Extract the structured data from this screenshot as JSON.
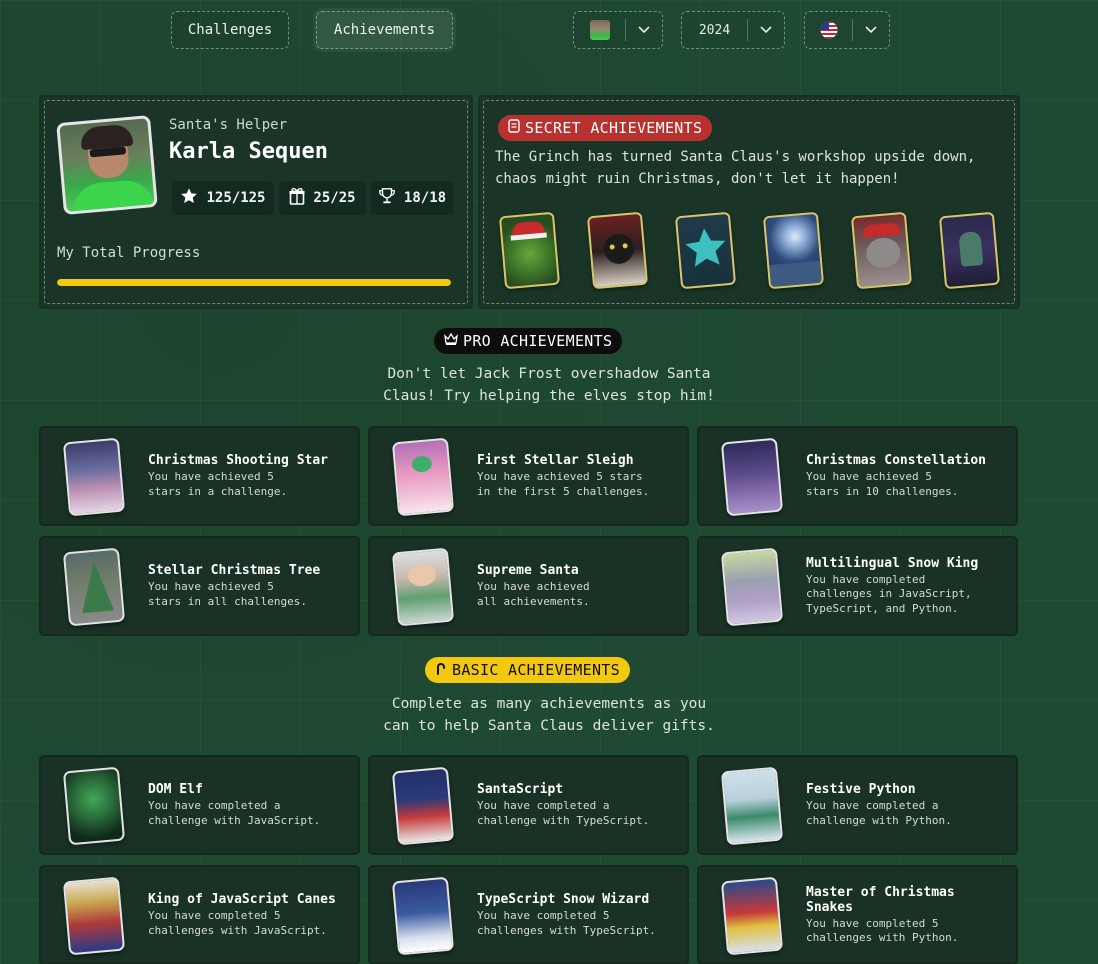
{
  "nav": {
    "challenges_label": "Challenges",
    "achievements_label": "Achievements",
    "year": "2024"
  },
  "profile": {
    "title": "Santa's Helper",
    "name": "Karla Sequen",
    "stats": [
      {
        "icon": "star-icon",
        "value": "125/125"
      },
      {
        "icon": "gift-icon",
        "value": "25/25"
      },
      {
        "icon": "trophy-icon",
        "value": "18/18"
      }
    ],
    "progress_label": "My Total Progress",
    "progress": 1.0
  },
  "secret": {
    "badge": "SECRET ACHIEVEMENTS",
    "description": "The Grinch has turned Santa Claus's workshop upside down, chaos might ruin Christmas, don't let it happen!",
    "cards": [
      "grinch-card",
      "black-cat-card",
      "teal-star-card",
      "moon-night-card",
      "gray-cat-card",
      "dark-wizard-card"
    ]
  },
  "pro": {
    "badge": "PRO ACHIEVEMENTS",
    "description_line1": "Don't let Jack Frost overshadow Santa",
    "description_line2": "Claus! Try helping the elves stop him!",
    "items": [
      {
        "title": "Christmas Shooting Star",
        "desc": "You have achieved 5\nstars in a challenge."
      },
      {
        "title": "First Stellar Sleigh",
        "desc": "You have achieved 5 stars\nin the first 5 challenges."
      },
      {
        "title": "Christmas Constellation",
        "desc": "You have achieved 5\nstars in 10 challenges."
      },
      {
        "title": "Stellar Christmas Tree",
        "desc": "You have achieved 5\nstars in all challenges."
      },
      {
        "title": "Supreme Santa",
        "desc": "You have achieved\nall achievements."
      },
      {
        "title": "Multilingual Snow King",
        "desc": "You have completed\nchallenges in JavaScript,\nTypeScript, and Python."
      }
    ]
  },
  "basic": {
    "badge": "BASIC ACHIEVEMENTS",
    "description_line1": "Complete as many achievements as you",
    "description_line2": "can to help Santa Claus deliver gifts.",
    "items": [
      {
        "title": "DOM Elf",
        "desc": "You have completed a\nchallenge with JavaScript."
      },
      {
        "title": "SantaScript",
        "desc": "You have completed a\nchallenge with TypeScript."
      },
      {
        "title": "Festive Python",
        "desc": "You have completed a\nchallenge with Python."
      },
      {
        "title": "King of JavaScript Canes",
        "desc": "You have completed 5\nchallenges with JavaScript."
      },
      {
        "title": "TypeScript Snow Wizard",
        "desc": "You have completed 5\nchallenges with TypeScript."
      },
      {
        "title": "Master of Christmas Snakes",
        "desc": "You have completed 5\nchallenges with Python."
      }
    ]
  },
  "colors": {
    "accent_yellow": "#f2c811",
    "secret_red": "#b8312f",
    "pro_black": "#0d0d0d",
    "panel": "#1a3527",
    "background": "#1f4a32"
  }
}
